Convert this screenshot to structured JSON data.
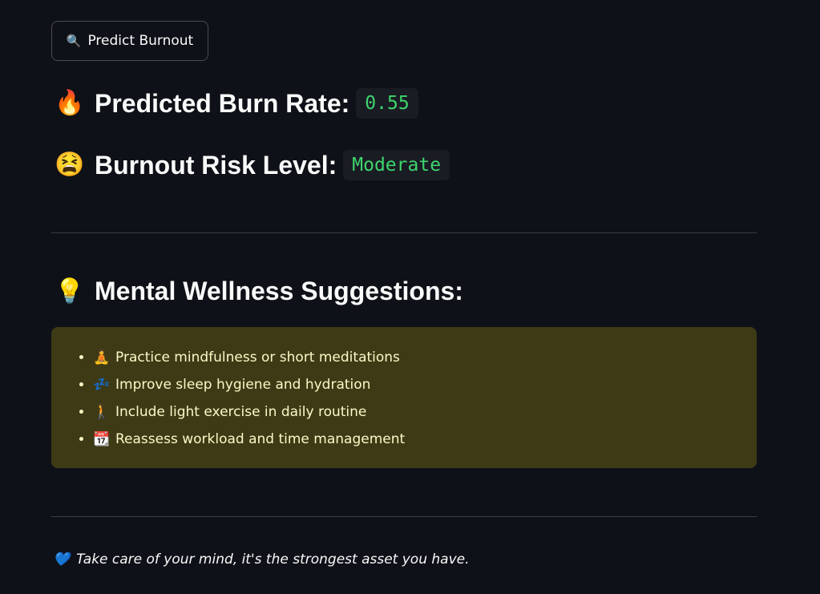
{
  "predict_button": {
    "icon": "magnifier-icon",
    "label": "Predict Burnout"
  },
  "burn_rate": {
    "icon": "fire-icon",
    "label": "Predicted Burn Rate:",
    "value": "0.55"
  },
  "risk_level": {
    "icon": "tired-face-icon",
    "label": "Burnout Risk Level:",
    "value": "Moderate"
  },
  "suggestions": {
    "icon": "light-bulb-icon",
    "heading": "Mental Wellness Suggestions:",
    "items": [
      {
        "icon": "meditation-icon",
        "text": "Practice mindfulness or short meditations"
      },
      {
        "icon": "sleep-icon",
        "text": "Improve sleep hygiene and hydration"
      },
      {
        "icon": "walking-icon",
        "text": "Include light exercise in daily routine"
      },
      {
        "icon": "calendar-icon",
        "text": "Reassess workload and time management"
      }
    ]
  },
  "footer": {
    "icon": "blue-heart-icon",
    "text": "Take care of your mind, it's the strongest asset you have."
  },
  "colors": {
    "background": "#0e1117",
    "code_text": "#3dd56d",
    "suggestion_box_bg": "#3e3a16",
    "suggestion_text": "#fdf8c6"
  }
}
